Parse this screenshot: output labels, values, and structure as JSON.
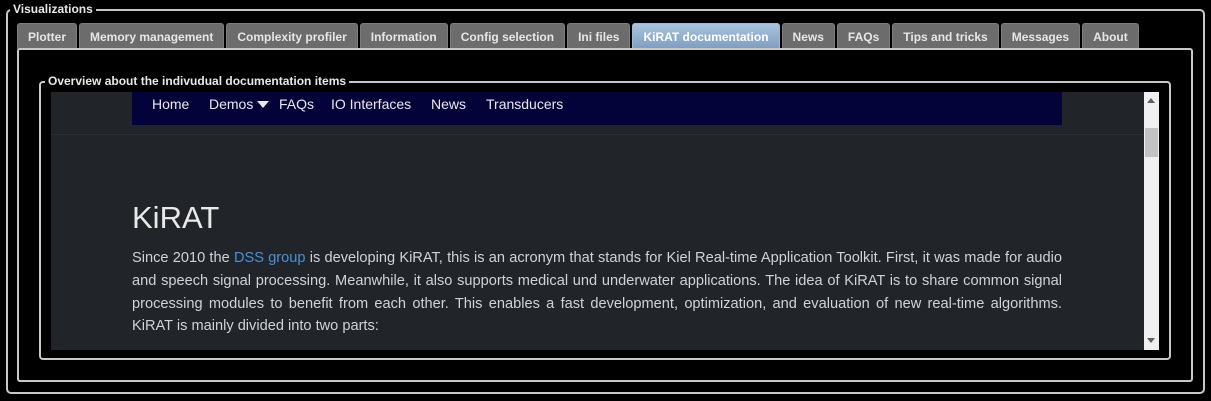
{
  "outer_group": {
    "title": "Visualizations"
  },
  "tabs": [
    {
      "label": "Plotter",
      "active": false
    },
    {
      "label": "Memory management",
      "active": false
    },
    {
      "label": "Complexity profiler",
      "active": false
    },
    {
      "label": "Information",
      "active": false
    },
    {
      "label": "Config selection",
      "active": false
    },
    {
      "label": "Ini files",
      "active": false
    },
    {
      "label": "KiRAT documentation",
      "active": true
    },
    {
      "label": "News",
      "active": false
    },
    {
      "label": "FAQs",
      "active": false
    },
    {
      "label": "Tips and tricks",
      "active": false
    },
    {
      "label": "Messages",
      "active": false
    },
    {
      "label": "About",
      "active": false
    }
  ],
  "inner_group": {
    "title": "Overview about the indivudual documentation items"
  },
  "browser": {
    "nav": {
      "home": "Home",
      "demos": "Demos",
      "faqs": "FAQs",
      "io_interfaces": "IO Interfaces",
      "news": "News",
      "transducers": "Transducers"
    },
    "page_title": "KiRAT",
    "intro": {
      "before_link": "Since 2010 the ",
      "link": "DSS group",
      "after_link": " is developing KiRAT, this is an acronym that stands for Kiel Real-time Application Toolkit. First, it was made for audio and speech signal processing. Meanwhile, it also supports medical und underwater applications. The idea of KiRAT is to share common signal processing modules to benefit from each other. This enables a fast development, optimization, and evaluation of new real-time algorithms. KiRAT is mainly divided into two parts:"
    }
  },
  "colors": {
    "active_tab": "#8eaacb",
    "inactive_tab": "#6c6c6c",
    "nav_background": "#03033a",
    "page_background": "#212529",
    "link": "#4a90d9"
  }
}
